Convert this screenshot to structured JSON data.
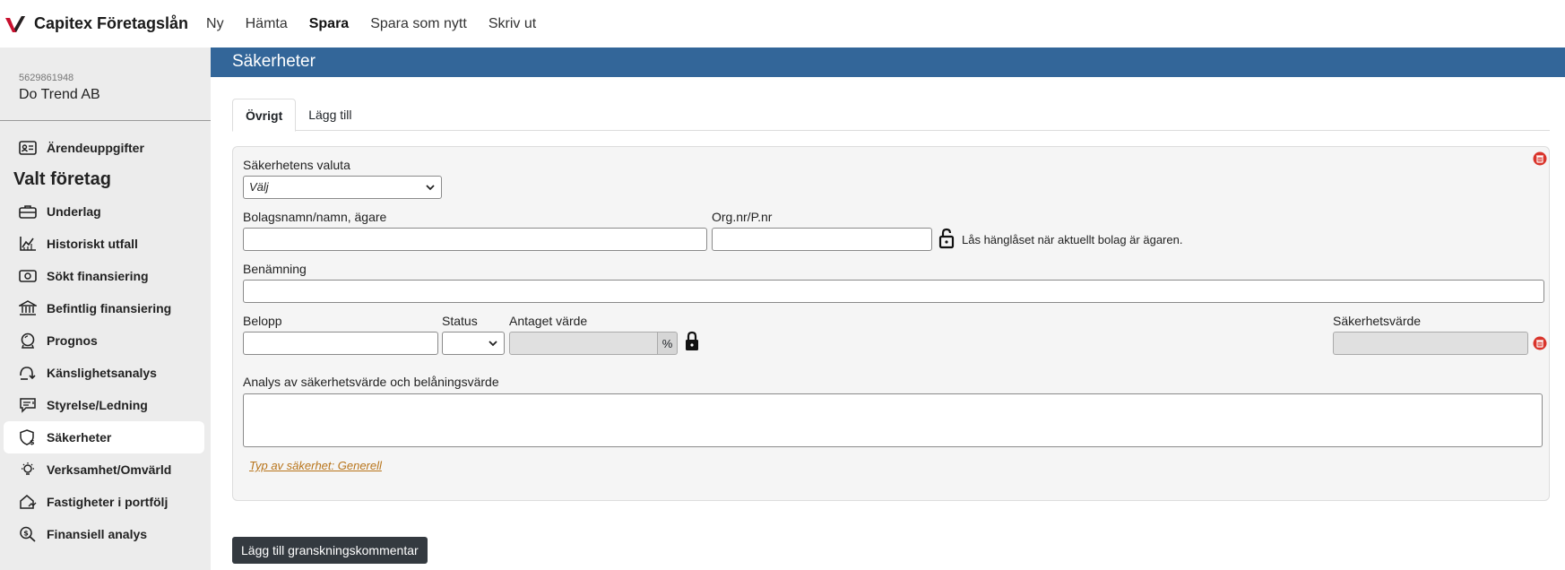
{
  "app": {
    "name": "Capitex Företagslån",
    "nav": [
      "Ny",
      "Hämta",
      "Spara",
      "Spara som nytt",
      "Skriv ut"
    ]
  },
  "company": {
    "id": "5629861948",
    "name": "Do Trend AB"
  },
  "sidebar": {
    "top_item": "Ärendeuppgifter",
    "heading": "Valt företag",
    "items": [
      "Underlag",
      "Historiskt utfall",
      "Sökt finansiering",
      "Befintlig finansiering",
      "Prognos",
      "Känslighetsanalys",
      "Styrelse/Ledning",
      "Säkerheter",
      "Verksamhet/Omvärld",
      "Fastigheter i portfölj",
      "Finansiell analys"
    ],
    "active": "Säkerheter"
  },
  "page": {
    "title": "Säkerheter",
    "tabs": [
      "Övrigt",
      "Lägg till"
    ]
  },
  "form": {
    "currency_label": "Säkerhetens valuta",
    "currency_value": "Välj",
    "owner_label": "Bolagsnamn/namn, ägare",
    "orgnr_label": "Org.nr/P.nr",
    "lock_hint": "Lås hänglåset när aktuellt bolag är ägaren.",
    "name_label": "Benämning",
    "amount_label": "Belopp",
    "status_label": "Status",
    "assumed_label": "Antaget värde",
    "percent": "%",
    "security_value_label": "Säkerhetsvärde",
    "analysis_label": "Analys av säkerhetsvärde och belåningsvärde",
    "type_link": "Typ av säkerhet: Generell"
  },
  "actions": {
    "add_review": "Lägg till granskningskommentar"
  }
}
